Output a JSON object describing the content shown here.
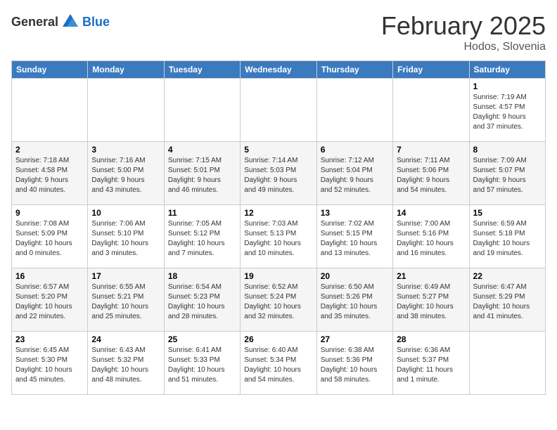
{
  "header": {
    "logo_general": "General",
    "logo_blue": "Blue",
    "month_year": "February 2025",
    "location": "Hodos, Slovenia"
  },
  "weekdays": [
    "Sunday",
    "Monday",
    "Tuesday",
    "Wednesday",
    "Thursday",
    "Friday",
    "Saturday"
  ],
  "weeks": [
    [
      {
        "day": "",
        "info": ""
      },
      {
        "day": "",
        "info": ""
      },
      {
        "day": "",
        "info": ""
      },
      {
        "day": "",
        "info": ""
      },
      {
        "day": "",
        "info": ""
      },
      {
        "day": "",
        "info": ""
      },
      {
        "day": "1",
        "info": "Sunrise: 7:19 AM\nSunset: 4:57 PM\nDaylight: 9 hours\nand 37 minutes."
      }
    ],
    [
      {
        "day": "2",
        "info": "Sunrise: 7:18 AM\nSunset: 4:58 PM\nDaylight: 9 hours\nand 40 minutes."
      },
      {
        "day": "3",
        "info": "Sunrise: 7:16 AM\nSunset: 5:00 PM\nDaylight: 9 hours\nand 43 minutes."
      },
      {
        "day": "4",
        "info": "Sunrise: 7:15 AM\nSunset: 5:01 PM\nDaylight: 9 hours\nand 46 minutes."
      },
      {
        "day": "5",
        "info": "Sunrise: 7:14 AM\nSunset: 5:03 PM\nDaylight: 9 hours\nand 49 minutes."
      },
      {
        "day": "6",
        "info": "Sunrise: 7:12 AM\nSunset: 5:04 PM\nDaylight: 9 hours\nand 52 minutes."
      },
      {
        "day": "7",
        "info": "Sunrise: 7:11 AM\nSunset: 5:06 PM\nDaylight: 9 hours\nand 54 minutes."
      },
      {
        "day": "8",
        "info": "Sunrise: 7:09 AM\nSunset: 5:07 PM\nDaylight: 9 hours\nand 57 minutes."
      }
    ],
    [
      {
        "day": "9",
        "info": "Sunrise: 7:08 AM\nSunset: 5:09 PM\nDaylight: 10 hours\nand 0 minutes."
      },
      {
        "day": "10",
        "info": "Sunrise: 7:06 AM\nSunset: 5:10 PM\nDaylight: 10 hours\nand 3 minutes."
      },
      {
        "day": "11",
        "info": "Sunrise: 7:05 AM\nSunset: 5:12 PM\nDaylight: 10 hours\nand 7 minutes."
      },
      {
        "day": "12",
        "info": "Sunrise: 7:03 AM\nSunset: 5:13 PM\nDaylight: 10 hours\nand 10 minutes."
      },
      {
        "day": "13",
        "info": "Sunrise: 7:02 AM\nSunset: 5:15 PM\nDaylight: 10 hours\nand 13 minutes."
      },
      {
        "day": "14",
        "info": "Sunrise: 7:00 AM\nSunset: 5:16 PM\nDaylight: 10 hours\nand 16 minutes."
      },
      {
        "day": "15",
        "info": "Sunrise: 6:59 AM\nSunset: 5:18 PM\nDaylight: 10 hours\nand 19 minutes."
      }
    ],
    [
      {
        "day": "16",
        "info": "Sunrise: 6:57 AM\nSunset: 5:20 PM\nDaylight: 10 hours\nand 22 minutes."
      },
      {
        "day": "17",
        "info": "Sunrise: 6:55 AM\nSunset: 5:21 PM\nDaylight: 10 hours\nand 25 minutes."
      },
      {
        "day": "18",
        "info": "Sunrise: 6:54 AM\nSunset: 5:23 PM\nDaylight: 10 hours\nand 28 minutes."
      },
      {
        "day": "19",
        "info": "Sunrise: 6:52 AM\nSunset: 5:24 PM\nDaylight: 10 hours\nand 32 minutes."
      },
      {
        "day": "20",
        "info": "Sunrise: 6:50 AM\nSunset: 5:26 PM\nDaylight: 10 hours\nand 35 minutes."
      },
      {
        "day": "21",
        "info": "Sunrise: 6:49 AM\nSunset: 5:27 PM\nDaylight: 10 hours\nand 38 minutes."
      },
      {
        "day": "22",
        "info": "Sunrise: 6:47 AM\nSunset: 5:29 PM\nDaylight: 10 hours\nand 41 minutes."
      }
    ],
    [
      {
        "day": "23",
        "info": "Sunrise: 6:45 AM\nSunset: 5:30 PM\nDaylight: 10 hours\nand 45 minutes."
      },
      {
        "day": "24",
        "info": "Sunrise: 6:43 AM\nSunset: 5:32 PM\nDaylight: 10 hours\nand 48 minutes."
      },
      {
        "day": "25",
        "info": "Sunrise: 6:41 AM\nSunset: 5:33 PM\nDaylight: 10 hours\nand 51 minutes."
      },
      {
        "day": "26",
        "info": "Sunrise: 6:40 AM\nSunset: 5:34 PM\nDaylight: 10 hours\nand 54 minutes."
      },
      {
        "day": "27",
        "info": "Sunrise: 6:38 AM\nSunset: 5:36 PM\nDaylight: 10 hours\nand 58 minutes."
      },
      {
        "day": "28",
        "info": "Sunrise: 6:36 AM\nSunset: 5:37 PM\nDaylight: 11 hours\nand 1 minute."
      },
      {
        "day": "",
        "info": ""
      }
    ]
  ]
}
